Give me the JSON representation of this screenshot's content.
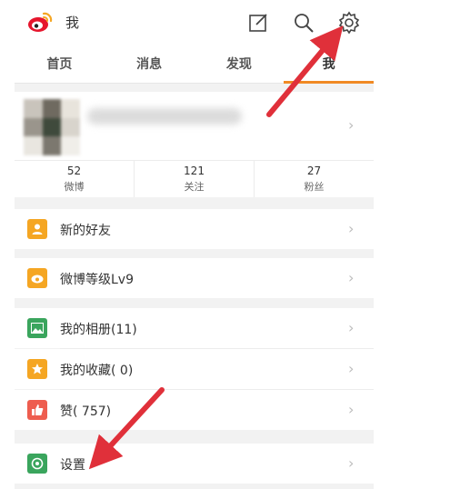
{
  "header": {
    "title": "我",
    "icons": [
      "weibo-logo",
      "compose-icon",
      "search-icon",
      "gear-icon"
    ]
  },
  "tabs": [
    {
      "label": "首页",
      "active": false
    },
    {
      "label": "消息",
      "active": false
    },
    {
      "label": "发现",
      "active": false
    },
    {
      "label": "我",
      "active": true
    }
  ],
  "stats": [
    {
      "count": "52",
      "label": "微博"
    },
    {
      "count": "121",
      "label": "关注"
    },
    {
      "count": "27",
      "label": "粉丝"
    }
  ],
  "menu": [
    {
      "label": "新的好友",
      "icon": "person-icon",
      "color": "#f5a623"
    },
    {
      "label": "微博等级Lv9",
      "icon": "level-icon",
      "color": "#f5a623"
    },
    {
      "label": "我的相册(11)",
      "icon": "photo-icon",
      "color": "#3aa55d"
    },
    {
      "label": "我的收藏( 0)",
      "icon": "star-icon",
      "color": "#f5a623"
    },
    {
      "label": "赞( 757)",
      "icon": "thumbs-up-icon",
      "color": "#ee5d4f"
    },
    {
      "label": "设置",
      "icon": "settings-icon",
      "color": "#3aa55d"
    }
  ],
  "colors": {
    "accent": "#f08a24",
    "annotation_arrow": "#e0303a"
  }
}
